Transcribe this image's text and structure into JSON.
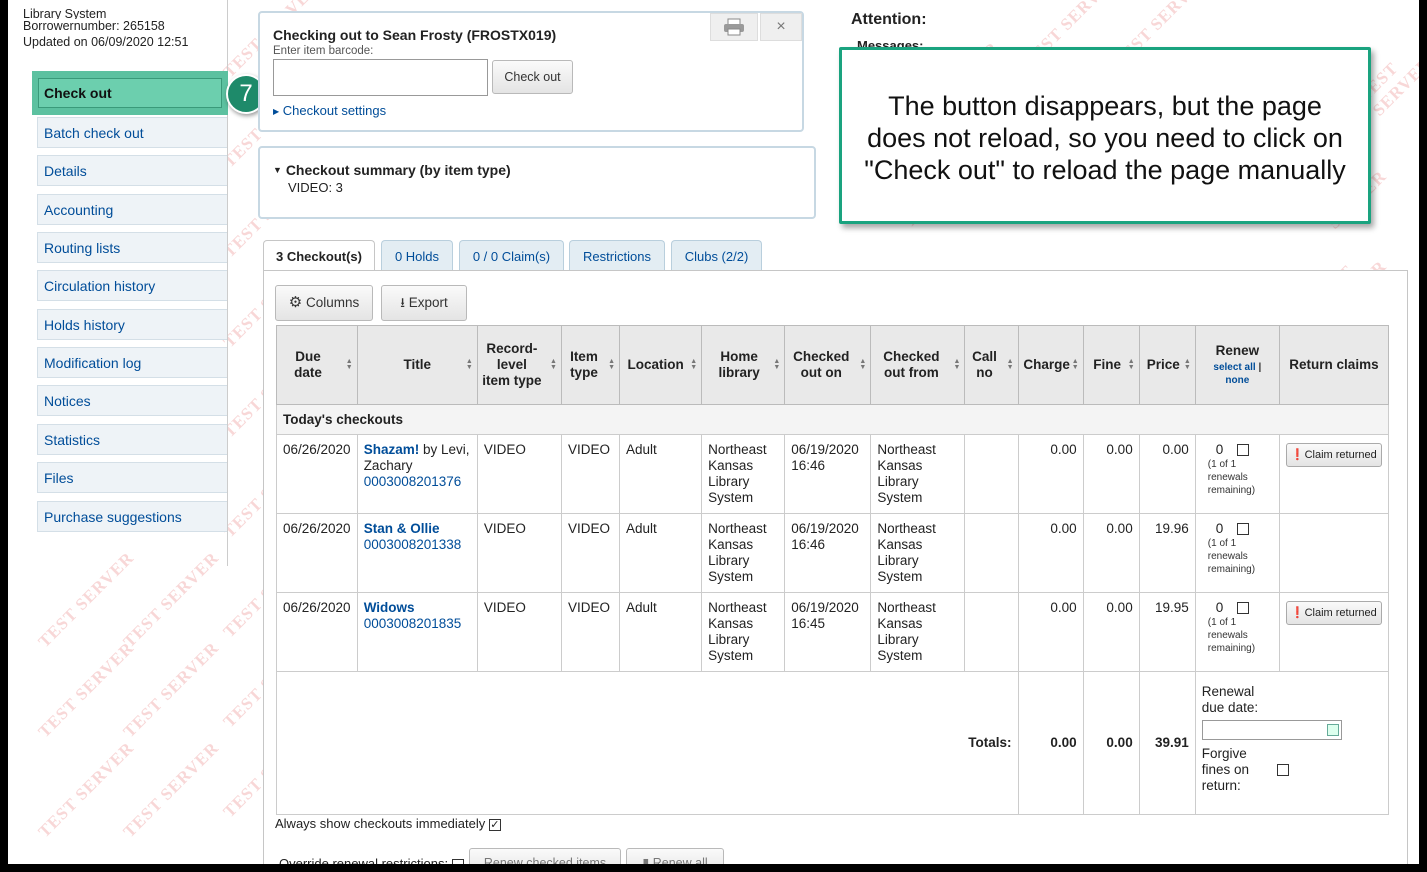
{
  "patron_info": {
    "library": "Library System",
    "borrowernumber": "Borrowernumber: 265158",
    "updated": "Updated on 06/09/2020 12:51"
  },
  "sidebar": {
    "items": [
      {
        "label": "Check out"
      },
      {
        "label": "Batch check out"
      },
      {
        "label": "Details"
      },
      {
        "label": "Accounting"
      },
      {
        "label": "Routing lists"
      },
      {
        "label": "Circulation history"
      },
      {
        "label": "Holds history"
      },
      {
        "label": "Modification log"
      },
      {
        "label": "Notices"
      },
      {
        "label": "Statistics"
      },
      {
        "label": "Files"
      },
      {
        "label": "Purchase suggestions"
      }
    ]
  },
  "step_badge": "7",
  "checkout": {
    "heading": "Checking out to Sean Frosty (FROSTX019)",
    "barcode_label": "Enter item barcode:",
    "barcode_value": "",
    "button": "Check out",
    "settings_link": "Checkout settings"
  },
  "summary": {
    "heading": "Checkout summary (by item type)",
    "line": "VIDEO: 3"
  },
  "attention": {
    "title": "Attention:",
    "messages": "Messages:"
  },
  "callout": {
    "lines": [
      "The button disappears, but the page",
      "does not reload, so you need to click on",
      "\"Check out\" to reload the page manually"
    ]
  },
  "tabs": [
    {
      "label": "3 Checkout(s)",
      "active": true
    },
    {
      "label": "0 Holds"
    },
    {
      "label": "0 / 0 Claim(s)"
    },
    {
      "label": "Restrictions"
    },
    {
      "label": "Clubs (2/2)"
    }
  ],
  "toolbar": {
    "columns": "Columns",
    "export": "Export"
  },
  "table": {
    "headers": [
      "Due date",
      "Title",
      "Record-level item type",
      "Item type",
      "Location",
      "Home library",
      "Checked out on",
      "Checked out from",
      "Call no",
      "Charge",
      "Fine",
      "Price",
      "Renew",
      "Return claims"
    ],
    "renew_select_all": "select all",
    "renew_none": "none",
    "group_label": "Today's checkouts",
    "rows": [
      {
        "due": "06/26/2020",
        "title": "Shazam!",
        "author": " by Levi, Zachary",
        "barcode": "0003008201376",
        "record_type": "VIDEO",
        "item_type": "VIDEO",
        "location": "Adult",
        "home": "Northeast Kansas Library System",
        "checked_out": "06/19/2020 16:46",
        "from": "Northeast Kansas Library System",
        "call": "",
        "charge": "0.00",
        "fine": "0.00",
        "price": "0.00",
        "renew_count": "0",
        "renew_note": "(1 of 1 renewals remaining)",
        "claim": "Claim returned"
      },
      {
        "due": "06/26/2020",
        "title": "Stan & Ollie",
        "author": "",
        "barcode": "0003008201338",
        "record_type": "VIDEO",
        "item_type": "VIDEO",
        "location": "Adult",
        "home": "Northeast Kansas Library System",
        "checked_out": "06/19/2020 16:46",
        "from": "Northeast Kansas Library System",
        "call": "",
        "charge": "0.00",
        "fine": "0.00",
        "price": "19.96",
        "renew_count": "0",
        "renew_note": "(1 of 1 renewals remaining)",
        "claim": ""
      },
      {
        "due": "06/26/2020",
        "title": "Widows",
        "author": "",
        "barcode": "0003008201835",
        "record_type": "VIDEO",
        "item_type": "VIDEO",
        "location": "Adult",
        "home": "Northeast Kansas Library System",
        "checked_out": "06/19/2020 16:45",
        "from": "Northeast Kansas Library System",
        "call": "",
        "charge": "0.00",
        "fine": "0.00",
        "price": "19.95",
        "renew_count": "0",
        "renew_note": "(1 of 1 renewals remaining)",
        "claim": "Claim returned"
      }
    ],
    "totals_label": "Totals:",
    "totals": {
      "charge": "0.00",
      "fine": "0.00",
      "price": "39.91"
    },
    "renewal_due_label": "Renewal due date:",
    "forgive_label": "Forgive fines on return:"
  },
  "footer": {
    "always_show": "Always show checkouts immediately",
    "override": "Override renewal restrictions:",
    "renew_checked": "Renew checked items",
    "renew_all": "Renew all"
  },
  "watermark": "TEST SERVER"
}
